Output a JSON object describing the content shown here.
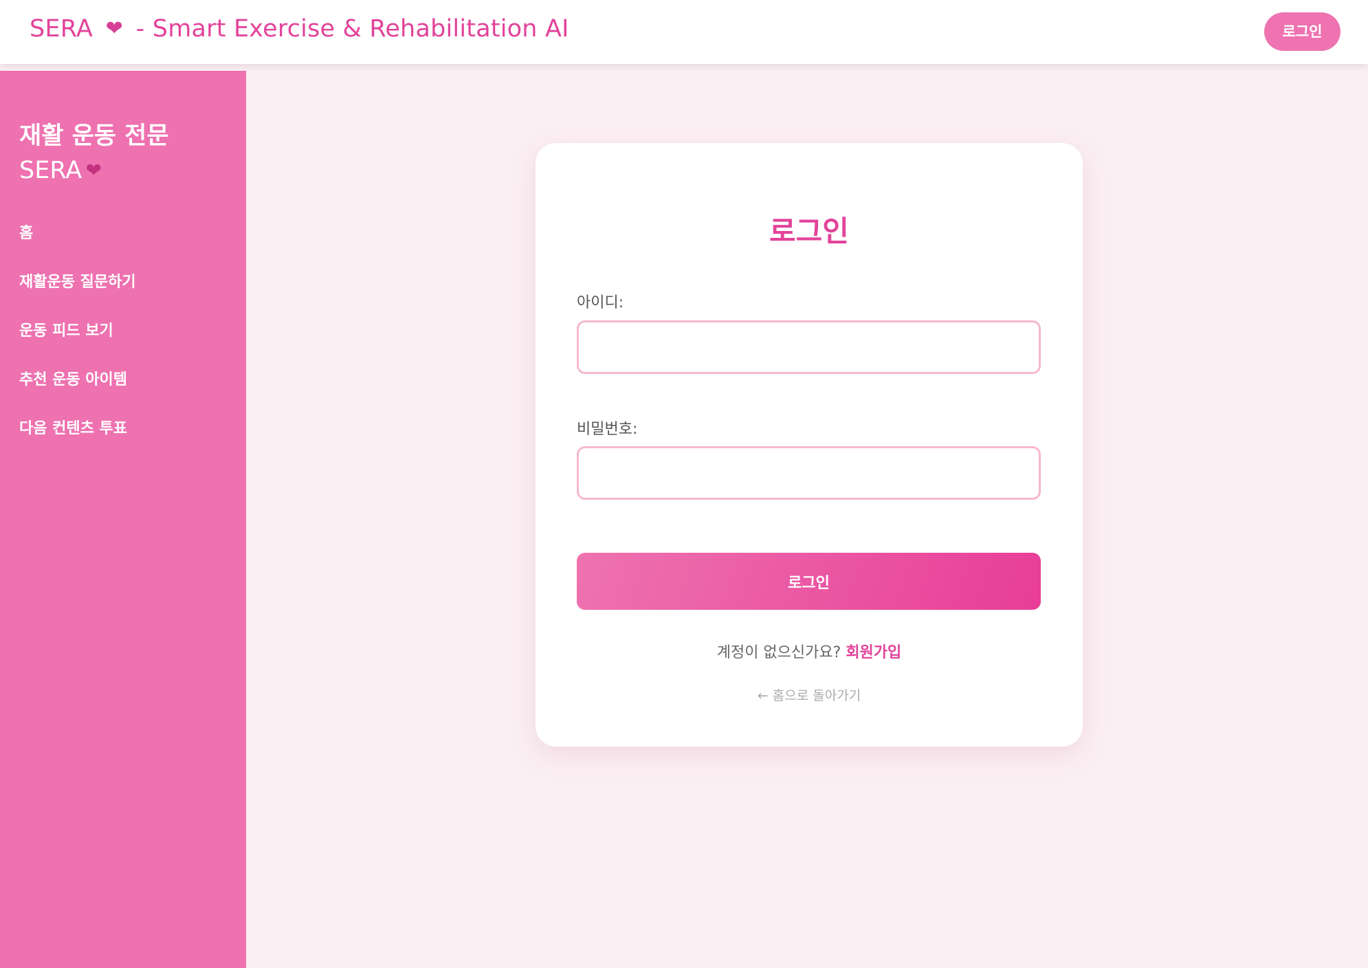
{
  "header": {
    "title_prefix": "SERA",
    "title_suffix": "- Smart Exercise & Rehabilitation AI",
    "heart_icon": "❤",
    "login_label": "로그인"
  },
  "sidebar": {
    "brand_line1": "재활 운동 전문",
    "brand_line2": "SERA",
    "items": [
      {
        "label": "홈"
      },
      {
        "label": "재활운동 질문하기"
      },
      {
        "label": "운동 피드 보기"
      },
      {
        "label": "추천 운동 아이템"
      },
      {
        "label": "다음 컨텐츠 투표"
      }
    ]
  },
  "login_form": {
    "title": "로그인",
    "id_label": "아이디:",
    "id_value": "",
    "password_label": "비밀번호:",
    "password_value": "",
    "submit_label": "로그인",
    "signup_prompt": "계정이 없으신가요? ",
    "signup_link": "회원가입",
    "home_link": "← 홈으로 돌아가기"
  },
  "colors": {
    "accent": "#e2439a",
    "sidebar": "#ee71b0",
    "background": "#fbeff4",
    "input_border": "#f5b8ce"
  },
  "icons": {
    "heart": "sparkling-hearts-icon"
  }
}
